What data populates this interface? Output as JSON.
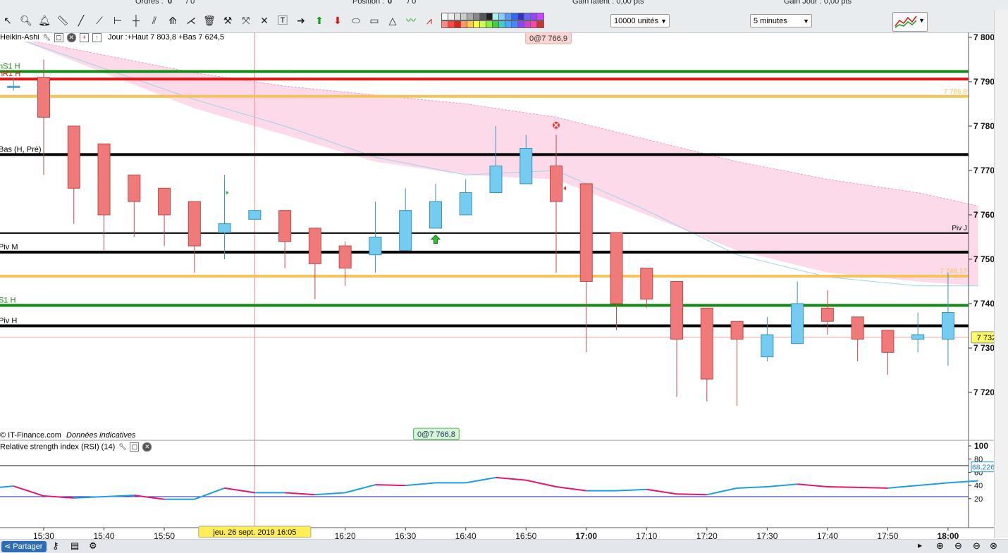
{
  "toolbar": {
    "orders_label": "Ordres :",
    "orders_value": "0",
    "orders_value2": "/ 0",
    "position_label": "Position :",
    "position_value": "0",
    "position_value2": "/ 0",
    "gain_latent": "Gain latent : 0,00 pts",
    "gain_jour": "Gain Jour : 0,00 pts",
    "quantity_select": "10000 unités",
    "timeframe_select": "5 minutes"
  },
  "colors": {
    "bull": "#74cdf0",
    "bear": "#f07a7a",
    "green_line": "#138a13",
    "red_line": "#e01515",
    "orange_line": "#f6c35a",
    "pink_band": "#fbd4e6",
    "rsi_up": "#1a9ee8",
    "rsi_down": "#e5166f"
  },
  "main_legend": {
    "chart_type": "Heikin-Ashi",
    "jour_info": "Jour :+Haut 7 803,8 +Bas 7 624,5"
  },
  "rsi_legend": {
    "title": "Relative strength index (RSI) (14)"
  },
  "badges": {
    "top": "0@7 766,9",
    "bottom": "0@7 766,8",
    "price": "7 732,4",
    "rsi_value": "68,226",
    "date_cursor": "jeu. 26 sept. 2019 16:05"
  },
  "copyright": "© IT-Finance.com",
  "data_note": "Données indicatives",
  "share_button": "Partager",
  "chart_data": [
    {
      "type": "candlestick",
      "style": "Heikin-Ashi",
      "x": [
        "15:25",
        "15:30",
        "15:35",
        "15:40",
        "15:45",
        "15:50",
        "15:55",
        "16:00",
        "16:05",
        "16:10",
        "16:15",
        "16:20",
        "16:25",
        "16:30",
        "16:35",
        "16:40",
        "16:45",
        "16:50",
        "16:55",
        "17:00",
        "17:05",
        "17:10",
        "17:15",
        "17:20",
        "17:25",
        "17:30",
        "17:35",
        "17:40",
        "17:45",
        "17:50",
        "17:55",
        "18:00"
      ],
      "open": [
        7789,
        7791,
        7780,
        7776,
        7769,
        7766,
        7763,
        7756,
        7759,
        7761,
        7757,
        7753,
        7751,
        7752,
        7757,
        7760,
        7765,
        7767,
        7771,
        7767,
        7756,
        7748,
        7745,
        7739,
        7736,
        7728,
        7731,
        7739,
        7737,
        7734,
        7732,
        7732
      ],
      "close": [
        7789,
        7782,
        7766,
        7760,
        7763,
        7760,
        7753,
        7758,
        7761,
        7754,
        7749,
        7748,
        7755,
        7761,
        7763,
        7765,
        7771,
        7775,
        7763,
        7745,
        7740,
        7741,
        7732,
        7723,
        7732,
        7733,
        7740,
        7736,
        7732,
        7729,
        7733,
        7738
      ],
      "high": [
        7791,
        7795,
        7780,
        7776,
        7769,
        7766,
        7763,
        7769,
        7761,
        7761,
        7757,
        7754,
        7763,
        7766,
        7767,
        7768,
        7780,
        7778,
        7778,
        7767,
        7756,
        7748,
        7745,
        7739,
        7736,
        7737,
        7745,
        7743,
        7737,
        7734,
        7738,
        7747
      ],
      "low": [
        7788,
        7769,
        7758,
        7752,
        7755,
        7753,
        7747,
        7750,
        7759,
        7748,
        7741,
        7744,
        7747,
        7753,
        7757,
        7760,
        7765,
        7767,
        7747,
        7729,
        7734,
        7739,
        7719,
        7718,
        7717,
        7727,
        7731,
        7733,
        7727,
        7724,
        7729,
        7726
      ],
      "ylim": [
        7710,
        7800
      ],
      "y_ticks": [
        "7 800",
        "7 790",
        "7 780",
        "7 770",
        "7 760",
        "7 750",
        "7 740",
        "7 730",
        "7 720"
      ],
      "y_tick_values": [
        7800,
        7790,
        7780,
        7770,
        7760,
        7750,
        7740,
        7730,
        7720
      ],
      "x_ticks": [
        "15:30",
        "15:40",
        "15:50",
        "16:20",
        "16:30",
        "16:40",
        "16:50",
        "17:00",
        "17:10",
        "17:20",
        "17:30",
        "17:40",
        "17:50",
        "18:00"
      ],
      "x_tick_values": [
        "15:30",
        "15:40",
        "15:50",
        "16:20",
        "16:30",
        "16:40",
        "16:50",
        "17:00",
        "17:10",
        "17:20",
        "17:30",
        "17:40",
        "17:50",
        "18:00"
      ],
      "x_ticks_bold": [
        "17:00",
        "18:00"
      ],
      "levels": [
        {
          "label": "nS1 H",
          "value": 7792.3,
          "color": "#138a13",
          "width": 4
        },
        {
          "label": "nR1 H",
          "value": 7790.6,
          "color": "#e01515",
          "width": 4
        },
        {
          "label": "",
          "value": 7786.7,
          "color": "#f6c35a",
          "width": 4,
          "right_label": "7 786,8"
        },
        {
          "label": "Bas (H, Pré)",
          "value": 7773.6,
          "color": "#000000",
          "width": 4
        },
        {
          "label": "",
          "value": 7755.9,
          "color": "#000000",
          "width": 2,
          "right_label": "Piv J"
        },
        {
          "label": "Piv M",
          "value": 7751.6,
          "color": "#000000",
          "width": 4
        },
        {
          "label": "",
          "value": 7746.2,
          "color": "#f6c35a",
          "width": 4,
          "right_label": "7 746,17"
        },
        {
          "label": "S1 H",
          "value": 7739.6,
          "color": "#138a13",
          "width": 4
        },
        {
          "label": "Piv H",
          "value": 7735.0,
          "color": "#000000",
          "width": 4
        }
      ],
      "price_line": 7732.4,
      "band": {
        "x": [
          "15:25",
          "15:40",
          "15:55",
          "16:10",
          "16:25",
          "16:40",
          "16:55",
          "17:10",
          "17:25",
          "17:40",
          "17:55",
          "18:05"
        ],
        "upper": [
          7800,
          7796,
          7792,
          7789,
          7787,
          7785,
          7782,
          7777,
          7772,
          7768,
          7765,
          7762
        ],
        "lower": [
          7800,
          7792,
          7784,
          7778,
          7772,
          7769,
          7768,
          7760,
          7752,
          7747,
          7745,
          7744
        ],
        "mid": [
          7800,
          7793,
          7786,
          7780,
          7773,
          7769,
          7770,
          7761,
          7751,
          7746,
          7744,
          7744
        ]
      },
      "signals": [
        {
          "x": "16:35",
          "kind": "buy-arrow",
          "y": 7754.5
        },
        {
          "x": "16:55",
          "kind": "exit-cross",
          "y": 7780.2
        }
      ]
    },
    {
      "type": "line",
      "name": "Relative strength index (RSI) (14)",
      "x": [
        "15:20",
        "15:25",
        "15:30",
        "15:35",
        "15:40",
        "15:45",
        "15:50",
        "15:55",
        "16:00",
        "16:05",
        "16:10",
        "16:15",
        "16:20",
        "16:25",
        "16:30",
        "16:35",
        "16:40",
        "16:45",
        "16:50",
        "16:55",
        "17:00",
        "17:05",
        "17:10",
        "17:15",
        "17:20",
        "17:25",
        "17:30",
        "17:35",
        "17:40",
        "17:45",
        "17:50",
        "17:55",
        "18:00",
        "18:05"
      ],
      "values": [
        35,
        39,
        24,
        21,
        23,
        25,
        19,
        19,
        36,
        29,
        29,
        26,
        29,
        41,
        40,
        44,
        44,
        52,
        48,
        38,
        32,
        32,
        34,
        27,
        26,
        36,
        38,
        42,
        38,
        37,
        36,
        40,
        44,
        47
      ],
      "ylim": [
        0,
        100
      ],
      "y_ticks": [
        "100",
        "80",
        "60",
        "40",
        "20"
      ],
      "y_tick_values": [
        100,
        80,
        60,
        40,
        20
      ],
      "overbought": 70,
      "oversold": 23
    }
  ]
}
